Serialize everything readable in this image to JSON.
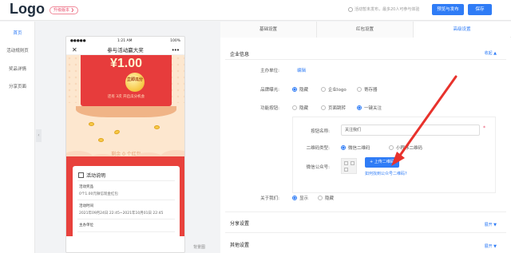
{
  "app": {
    "logo": "Logo",
    "upgrade_badge": "升级版本 ❯",
    "notice": "活动暂未发布，最多20人可参与体验",
    "preview_button": "预览与发布",
    "save_button": "保存"
  },
  "sidebar": {
    "items": [
      {
        "label": "首页",
        "active": true
      },
      {
        "label": "活动规则页",
        "active": false
      },
      {
        "label": "奖品详情",
        "active": false
      },
      {
        "label": "分享页面",
        "active": false
      }
    ],
    "collapse_glyph": "‹"
  },
  "phone": {
    "status": {
      "carrier": "●●●●●",
      "time": "1:21 AM",
      "battery": "100%"
    },
    "title": "参与活动赢大奖",
    "close_glyph": "✕",
    "more_glyph": "•••",
    "amount": "¥1.00",
    "coin_text": "立即瓜分",
    "card_note": "还有 3次 开启瓜分机会",
    "remaining": "剩余 0 个红包",
    "description": {
      "title": "活动说明",
      "rows": [
        {
          "label": "活动奖品",
          "value": "0个1.00元微信现金红包"
        },
        {
          "label": "活动时间",
          "value": "2021年09月24日 22:45~2021年10月01日 22:45"
        },
        {
          "label": "主办单位",
          "value": ""
        }
      ]
    }
  },
  "background_label": "背景图",
  "panel": {
    "tabs": [
      {
        "label": "基础设置",
        "active": false
      },
      {
        "label": "红包设置",
        "active": false
      },
      {
        "label": "高级设置",
        "active": true
      }
    ],
    "enterprise": {
      "title": "企业信息",
      "toggle": "收起 ▲",
      "organizer_label": "主办单位:",
      "organizer_edit": "编辑",
      "brand_label": "品牌曝光:",
      "brand_options": [
        {
          "label": "隐藏",
          "selected": true
        },
        {
          "label": "企业logo",
          "selected": false
        },
        {
          "label": "寄存器",
          "selected": false
        }
      ],
      "function_label": "功能按钮:",
      "function_options": [
        {
          "label": "隐藏",
          "selected": false
        },
        {
          "label": "页面跳转",
          "selected": false
        },
        {
          "label": "一键关注",
          "selected": true
        }
      ],
      "button_name_label": "按钮名称:",
      "button_name_value": "关注我们",
      "qr_type_label": "二维码类型:",
      "qr_type_options": [
        {
          "label": "微信二维码",
          "selected": true
        },
        {
          "label": "小程序二维码",
          "selected": false
        }
      ],
      "wechat_label": "微信公众号:",
      "upload_button": "+ 上传二维码",
      "find_qr_link": "如何找到公众号二维码?",
      "about_label": "关于我们:",
      "about_options": [
        {
          "label": "显示",
          "selected": true
        },
        {
          "label": "隐藏",
          "selected": false
        }
      ]
    },
    "share": {
      "title": "分享设置",
      "toggle": "展开 ▼"
    },
    "other": {
      "title": "其他设置",
      "toggle": "展开 ▼"
    }
  },
  "colors": {
    "accent": "#2f7cf6",
    "packet_red": "#e73c3c",
    "annotation_arrow": "#e8322c"
  }
}
